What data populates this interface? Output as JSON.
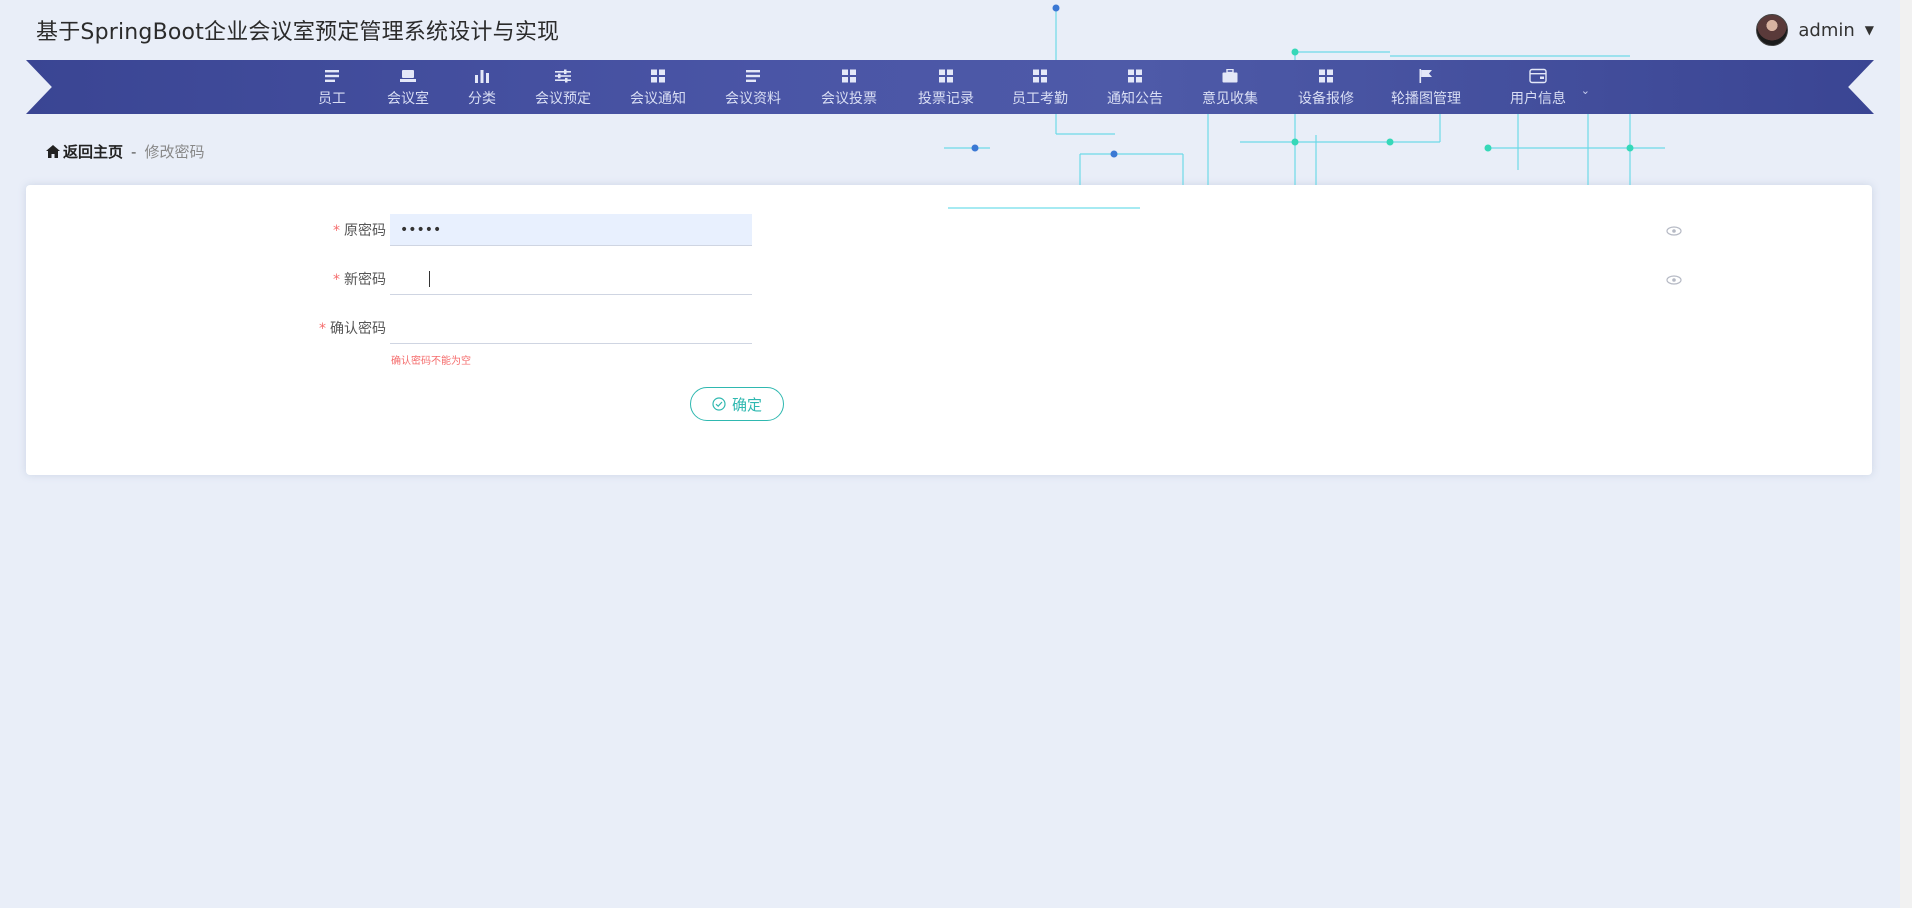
{
  "site": {
    "title": "基于SpringBoot企业会议室预定管理系统设计与实现"
  },
  "user": {
    "name": "admin"
  },
  "nav": {
    "items": [
      {
        "label": "员工",
        "icon": "list-icon"
      },
      {
        "label": "会议室",
        "icon": "card-icon"
      },
      {
        "label": "分类",
        "icon": "bar-chart-icon"
      },
      {
        "label": "会议预定",
        "icon": "sliders-icon"
      },
      {
        "label": "会议通知",
        "icon": "grid-icon"
      },
      {
        "label": "会议资料",
        "icon": "list-icon"
      },
      {
        "label": "会议投票",
        "icon": "grid-icon"
      },
      {
        "label": "投票记录",
        "icon": "grid-icon"
      },
      {
        "label": "员工考勤",
        "icon": "grid-icon"
      },
      {
        "label": "通知公告",
        "icon": "grid-icon"
      },
      {
        "label": "意见收集",
        "icon": "briefcase-icon"
      },
      {
        "label": "设备报修",
        "icon": "grid-icon"
      },
      {
        "label": "轮播图管理",
        "icon": "flag-icon"
      },
      {
        "label": "用户信息",
        "icon": "wallet-icon"
      }
    ]
  },
  "breadcrumb": {
    "home": "返回主页",
    "separator": "-",
    "current": "修改密码"
  },
  "form": {
    "old_password": {
      "label": "原密码",
      "value": "•••••"
    },
    "new_password": {
      "label": "新密码",
      "value": ""
    },
    "confirm_password": {
      "label": "确认密码",
      "value": "",
      "error": "确认密码不能为空"
    },
    "required_mark": "*",
    "submit_label": "确定"
  },
  "colors": {
    "nav_bg": "#4a55a6",
    "accent": "#2fb8b0",
    "error": "#f56c6c",
    "page_bg": "#e9eef8"
  }
}
